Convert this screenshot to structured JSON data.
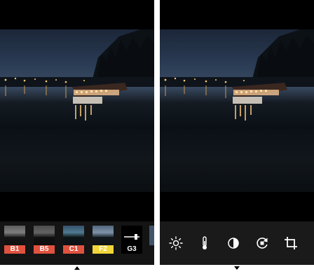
{
  "filters": [
    {
      "label": "B1",
      "color": "#e0523e",
      "style": "bw"
    },
    {
      "label": "B5",
      "color": "#e0523e",
      "style": "bw"
    },
    {
      "label": "C1",
      "color": "#e0523e",
      "style": "warm"
    },
    {
      "label": "F2",
      "color": "#f2d53a",
      "style": "yellow"
    },
    {
      "label": "G3",
      "color": "#000000",
      "style": "slider"
    }
  ],
  "tools": [
    {
      "icon": "brightness-sun-icon"
    },
    {
      "icon": "temperature-thermometer-icon"
    },
    {
      "icon": "contrast-icon"
    },
    {
      "icon": "rotate-icon"
    },
    {
      "icon": "crop-icon"
    }
  ],
  "colors": {
    "background": "#000000",
    "toolbar": "#141414",
    "divider": "#ffffff"
  }
}
